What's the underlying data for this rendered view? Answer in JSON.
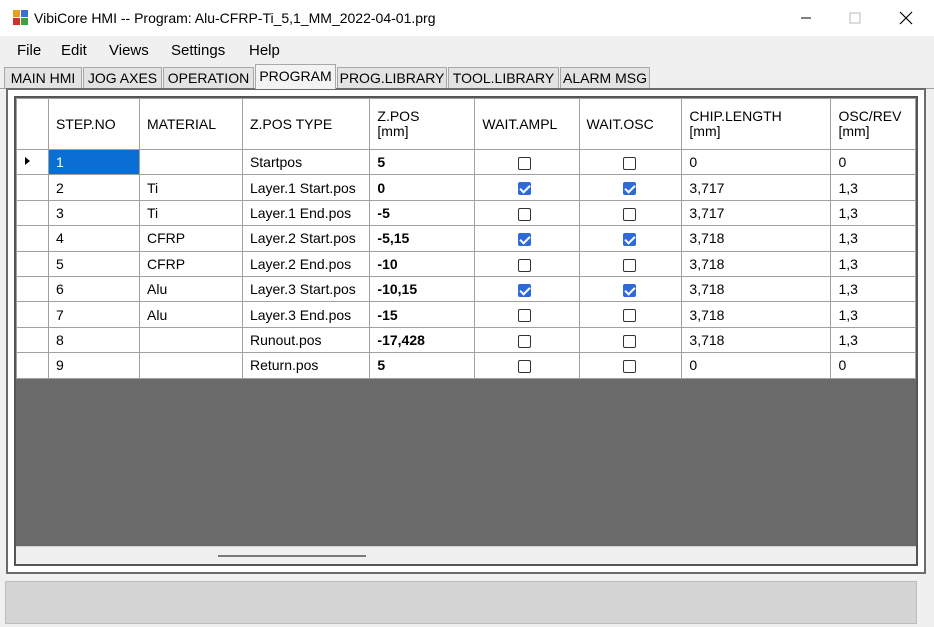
{
  "window": {
    "title": "VibiCore HMI -- Program: Alu-CFRP-Ti_5,1_MM_2022-04-01.prg",
    "icon": "app-grid-icon",
    "controls": [
      "minimize-icon",
      "maximize-icon",
      "close-icon"
    ]
  },
  "menu": [
    "File",
    "Edit",
    "Views",
    "Settings",
    "Help"
  ],
  "tabs": [
    {
      "label": "MAIN HMI",
      "active": false
    },
    {
      "label": "JOG AXES",
      "active": false
    },
    {
      "label": "OPERATION",
      "active": false
    },
    {
      "label": "PROGRAM",
      "active": true
    },
    {
      "label": "PROG.LIBRARY",
      "active": false
    },
    {
      "label": "TOOL.LIBRARY",
      "active": false
    },
    {
      "label": "ALARM MSG",
      "active": false
    }
  ],
  "grid": {
    "columns": [
      {
        "line1": "STEP.NO",
        "line2": ""
      },
      {
        "line1": "MATERIAL",
        "line2": ""
      },
      {
        "line1": "Z.POS TYPE",
        "line2": ""
      },
      {
        "line1": "Z.POS",
        "line2": "[mm]"
      },
      {
        "line1": "WAIT.AMPL",
        "line2": ""
      },
      {
        "line1": "WAIT.OSC",
        "line2": ""
      },
      {
        "line1": "CHIP.LENGTH",
        "line2": "[mm]"
      },
      {
        "line1": "OSC/REV",
        "line2": "[mm]"
      }
    ],
    "current_row_marker": "row-pointer-icon",
    "selected_cell": {
      "row": 0,
      "column": "STEP.NO"
    },
    "rows": [
      {
        "step": "1",
        "material": "",
        "type": "Startpos",
        "zpos": "5",
        "wait_ampl": false,
        "wait_osc": false,
        "chip_length": "0",
        "osc_rev": "0"
      },
      {
        "step": "2",
        "material": "Ti",
        "type": "Layer.1 Start.pos",
        "zpos": "0",
        "wait_ampl": true,
        "wait_osc": true,
        "chip_length": "3,717",
        "osc_rev": "1,3"
      },
      {
        "step": "3",
        "material": "Ti",
        "type": "Layer.1 End.pos",
        "zpos": "-5",
        "wait_ampl": false,
        "wait_osc": false,
        "chip_length": "3,717",
        "osc_rev": "1,3"
      },
      {
        "step": "4",
        "material": "CFRP",
        "type": "Layer.2 Start.pos",
        "zpos": "-5,15",
        "wait_ampl": true,
        "wait_osc": true,
        "chip_length": "3,718",
        "osc_rev": "1,3"
      },
      {
        "step": "5",
        "material": "CFRP",
        "type": "Layer.2 End.pos",
        "zpos": "-10",
        "wait_ampl": false,
        "wait_osc": false,
        "chip_length": "3,718",
        "osc_rev": "1,3"
      },
      {
        "step": "6",
        "material": "Alu",
        "type": "Layer.3 Start.pos",
        "zpos": "-10,15",
        "wait_ampl": true,
        "wait_osc": true,
        "chip_length": "3,718",
        "osc_rev": "1,3"
      },
      {
        "step": "7",
        "material": "Alu",
        "type": "Layer.3 End.pos",
        "zpos": "-15",
        "wait_ampl": false,
        "wait_osc": false,
        "chip_length": "3,718",
        "osc_rev": "1,3"
      },
      {
        "step": "8",
        "material": "",
        "type": "Runout.pos",
        "zpos": "-17,428",
        "wait_ampl": false,
        "wait_osc": false,
        "chip_length": "3,718",
        "osc_rev": "1,3"
      },
      {
        "step": "9",
        "material": "",
        "type": "Return.pos",
        "zpos": "5",
        "wait_ampl": false,
        "wait_osc": false,
        "chip_length": "0",
        "osc_rev": "0"
      }
    ]
  },
  "colors": {
    "selection": "#0a6fd3",
    "checkbox_checked": "#2e6bd8",
    "grid_background": "#6b6b6b",
    "status_bar": "#d4d4d4"
  }
}
